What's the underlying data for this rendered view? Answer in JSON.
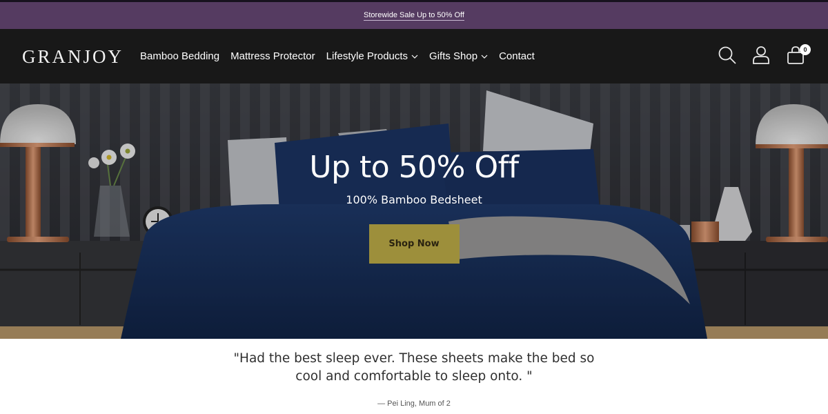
{
  "announcement": {
    "text": "Storewide Sale Up to 50% Off"
  },
  "header": {
    "logo": "GRANJOY",
    "nav": [
      {
        "label": "Bamboo Bedding",
        "has_dropdown": false
      },
      {
        "label": "Mattress Protector",
        "has_dropdown": false
      },
      {
        "label": "Lifestyle Products",
        "has_dropdown": true
      },
      {
        "label": "Gifts Shop",
        "has_dropdown": true
      },
      {
        "label": "Contact",
        "has_dropdown": false
      }
    ],
    "icons": {
      "search": "search-icon",
      "account": "user-icon",
      "cart": "shopping-bag-icon"
    },
    "cart_count": "0"
  },
  "hero": {
    "title": "Up to 50% Off",
    "subtitle": "100% Bamboo Bedsheet",
    "cta_label": "Shop Now",
    "cta_color": "#9d8f3b"
  },
  "testimonial": {
    "quote": "\"Had the best sleep ever. These sheets make the bed so cool and comfortable to sleep onto. \"",
    "author": "— Pei Ling, Mum of 2"
  },
  "colors": {
    "announcement_bg": "#553b61",
    "header_bg": "#181818"
  }
}
